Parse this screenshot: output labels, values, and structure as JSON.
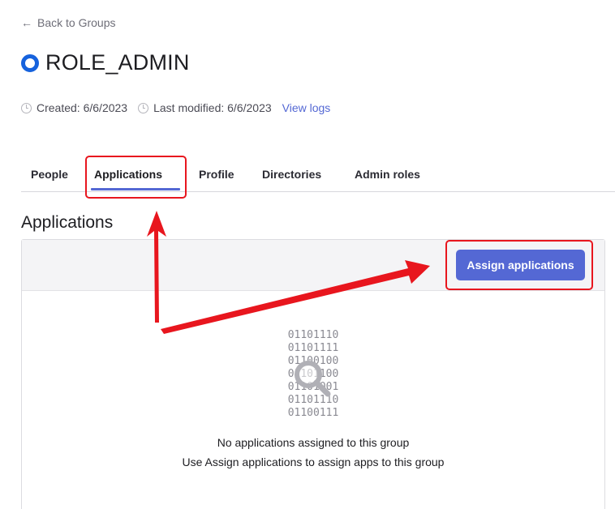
{
  "back_link": {
    "arrow": "←",
    "label": "Back to Groups"
  },
  "group": {
    "icon": "group-ring-icon",
    "title": "ROLE_ADMIN"
  },
  "meta": {
    "created": "Created: 6/6/2023",
    "last_modified": "Last modified: 6/6/2023",
    "view_logs": "View logs"
  },
  "tabs": [
    {
      "label": "People",
      "active": false
    },
    {
      "label": "Applications",
      "active": true
    },
    {
      "label": "Profile",
      "active": false
    },
    {
      "label": "Directories",
      "active": false
    },
    {
      "label": "Admin roles",
      "active": false
    }
  ],
  "section": {
    "heading": "Applications"
  },
  "toolbar": {
    "assign_label": "Assign applications"
  },
  "empty_state": {
    "binary_lines": [
      "01101110",
      "01101111",
      "01100100",
      "01101100",
      "01101001",
      "01101110",
      "01100111"
    ],
    "message": "No applications assigned to this group",
    "hint": "Use Assign applications to assign apps to this group"
  },
  "colors": {
    "accent": "#5468d4",
    "brand_icon": "#1662dd",
    "annotation": "#e8161e"
  }
}
